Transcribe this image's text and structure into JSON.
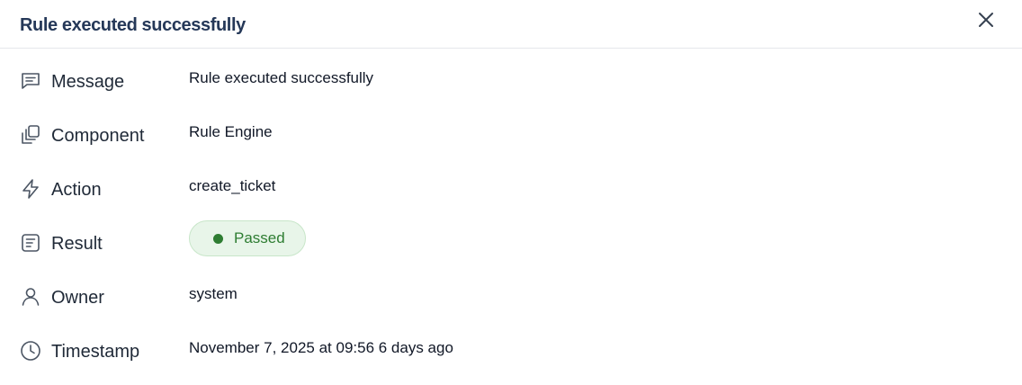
{
  "header": {
    "title": "Rule executed successfully"
  },
  "colors": {
    "passed": "#2e7d32",
    "passed_bg": "#e8f5e9",
    "title": "#253858"
  },
  "fields": {
    "message": {
      "icon": "message-icon",
      "label": "Message",
      "value": "Rule executed successfully"
    },
    "component": {
      "icon": "component-icon",
      "label": "Component",
      "value": "Rule Engine"
    },
    "action": {
      "icon": "lightning-icon",
      "label": "Action",
      "value": "create_ticket"
    },
    "result": {
      "icon": "result-icon",
      "label": "Result",
      "value": "Passed"
    },
    "owner": {
      "icon": "user-icon",
      "label": "Owner",
      "value": "system"
    },
    "timestamp": {
      "icon": "clock-icon",
      "label": "Timestamp",
      "value": "November 7, 2025 at 09:56 6 days ago"
    }
  }
}
